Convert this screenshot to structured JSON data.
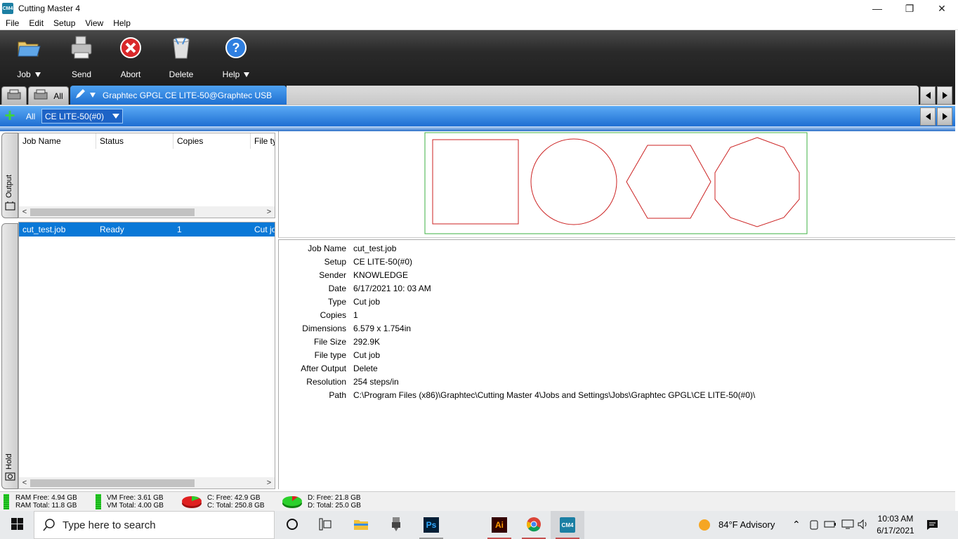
{
  "window": {
    "title": "Cutting Master 4",
    "icon_text": "CM4"
  },
  "menu": [
    "File",
    "Edit",
    "Setup",
    "View",
    "Help"
  ],
  "toolbar": {
    "job": "Job",
    "send": "Send",
    "abort": "Abort",
    "delete": "Delete",
    "help": "Help"
  },
  "device_tabs": {
    "all": "All",
    "active": "Graphtec GPGL CE LITE-50@Graphtec USB"
  },
  "setup_tabs": {
    "all": "All",
    "selected": "CE LITE-50(#0)"
  },
  "side_tabs": {
    "output": "Output",
    "hold": "Hold"
  },
  "columns": [
    "Job Name",
    "Status",
    "Copies",
    "File ty"
  ],
  "jobs": [
    {
      "name": "cut_test.job",
      "status": "Ready",
      "copies": "1",
      "type": "Cut jo"
    }
  ],
  "details": [
    {
      "k": "Job Name",
      "v": "cut_test.job"
    },
    {
      "k": "Setup",
      "v": "CE LITE-50(#0)"
    },
    {
      "k": "Sender",
      "v": "KNOWLEDGE"
    },
    {
      "k": "Date",
      "v": "6/17/2021 10: 03 AM"
    },
    {
      "k": "Type",
      "v": "Cut job"
    },
    {
      "k": "Copies",
      "v": "1"
    },
    {
      "k": "Dimensions",
      "v": "6.579 x 1.754in"
    },
    {
      "k": "File Size",
      "v": "292.9K"
    },
    {
      "k": "File type",
      "v": "Cut job"
    },
    {
      "k": "After Output",
      "v": "Delete"
    },
    {
      "k": "Resolution",
      "v": "254 steps/in"
    },
    {
      "k": "Path",
      "v": "C:\\Program Files (x86)\\Graphtec\\Cutting Master 4\\Jobs and Settings\\Jobs\\Graphtec GPGL\\CE LITE-50(#0)\\"
    }
  ],
  "status": {
    "ram_free": "RAM Free: 4.94 GB",
    "ram_total": "RAM Total: 11.8 GB",
    "vm_free": "VM Free: 3.61 GB",
    "vm_total": "VM Total: 4.00 GB",
    "c_free": "C: Free: 42.9 GB",
    "c_total": "C: Total: 250.8 GB",
    "d_free": "D: Free: 21.8 GB",
    "d_total": "D: Total: 25.0 GB"
  },
  "taskbar": {
    "search_placeholder": "Type here to search",
    "weather": "84°F  Advisory",
    "time": "10:03 AM",
    "date": "6/17/2021",
    "ps_label": "Ps",
    "ai_label": "Ai",
    "cm_label": "CM4"
  },
  "colors": {
    "accent_blue": "#0a78d7",
    "preview_border": "#3cb043",
    "shape_stroke": "#cc2222"
  }
}
